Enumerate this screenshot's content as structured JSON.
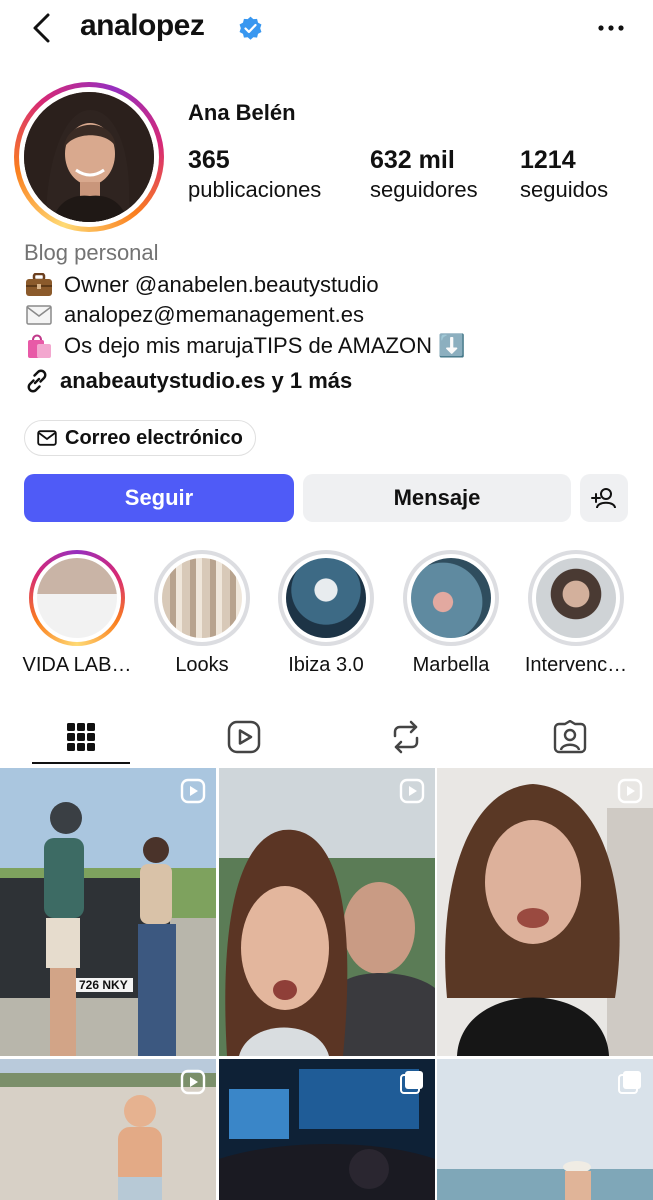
{
  "header": {
    "username": "analopez",
    "back_icon": "chevron-left-icon",
    "verified_icon": "verified-badge-icon",
    "more_icon": "more-horizontal-icon"
  },
  "profile": {
    "full_name": "Ana Belén",
    "stats": [
      {
        "count": "365",
        "label": "publicaciones"
      },
      {
        "count": "632 mil",
        "label": "seguidores"
      },
      {
        "count": "1214",
        "label": "seguidos"
      }
    ]
  },
  "bio": {
    "category": "Blog personal",
    "lines": [
      {
        "emoji": "briefcase-icon",
        "text": "Owner @anabelen.beautystudio"
      },
      {
        "emoji": "envelope-icon",
        "text": "analopez@memanagement.es"
      },
      {
        "emoji": "shopping-bags-icon",
        "text": "Os dejo mis marujaTIPS de AMAZON ⬇️"
      }
    ],
    "link_text": "anabeautystudio.es y 1 más"
  },
  "contact": {
    "email_label": "Correo electrónico"
  },
  "actions": {
    "follow_label": "Seguir",
    "message_label": "Mensaje",
    "add_icon": "add-person-icon"
  },
  "highlights": [
    {
      "label": "VIDA LAB…",
      "active": true
    },
    {
      "label": "Looks",
      "active": false
    },
    {
      "label": "Ibiza 3.0",
      "active": false
    },
    {
      "label": "Marbella",
      "active": false
    },
    {
      "label": "Intervenc…",
      "active": false
    }
  ],
  "tabs": [
    {
      "icon": "grid-icon",
      "selected": true
    },
    {
      "icon": "reels-icon",
      "selected": false
    },
    {
      "icon": "reposts-icon",
      "selected": false
    },
    {
      "icon": "tagged-icon",
      "selected": false
    }
  ],
  "posts": [
    {
      "type": "reel",
      "plate_text": "726 NKY"
    },
    {
      "type": "reel"
    },
    {
      "type": "reel"
    },
    {
      "type": "reel"
    },
    {
      "type": "carousel"
    },
    {
      "type": "carousel"
    }
  ],
  "colors": {
    "accent": "#4f5bf7",
    "verified": "#3897f0",
    "secondary_button": "#eff0f2",
    "muted_text": "#737373"
  }
}
